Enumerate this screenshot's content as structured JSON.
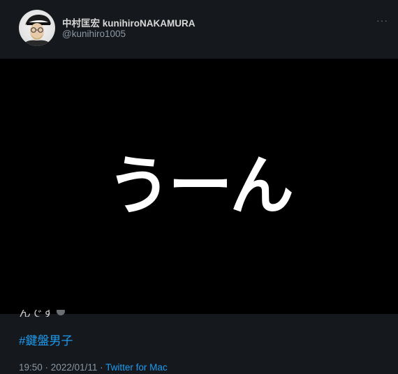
{
  "tweet": {
    "author": {
      "display_name": "中村匡宏 kunihiroNAKAMURA",
      "handle": "@kunihiro1005",
      "avatar_icon": "avatar-photo-icon"
    },
    "more_menu_label": "···",
    "more_icon": "more-options-icon",
    "media": {
      "overlay_text": "うーん",
      "background": "#000000"
    },
    "body_partial_text": "んです",
    "hashtag": "#鍵盤男子",
    "timestamp": {
      "time": "19:50",
      "separator1": " · ",
      "date": "2022/01/11",
      "separator2": " · ",
      "source": "Twitter for Mac"
    }
  },
  "colors": {
    "background": "#15181c",
    "primary_text": "#d9d9d9",
    "secondary_text": "#8b98a5",
    "link": "#1d9bf0"
  }
}
